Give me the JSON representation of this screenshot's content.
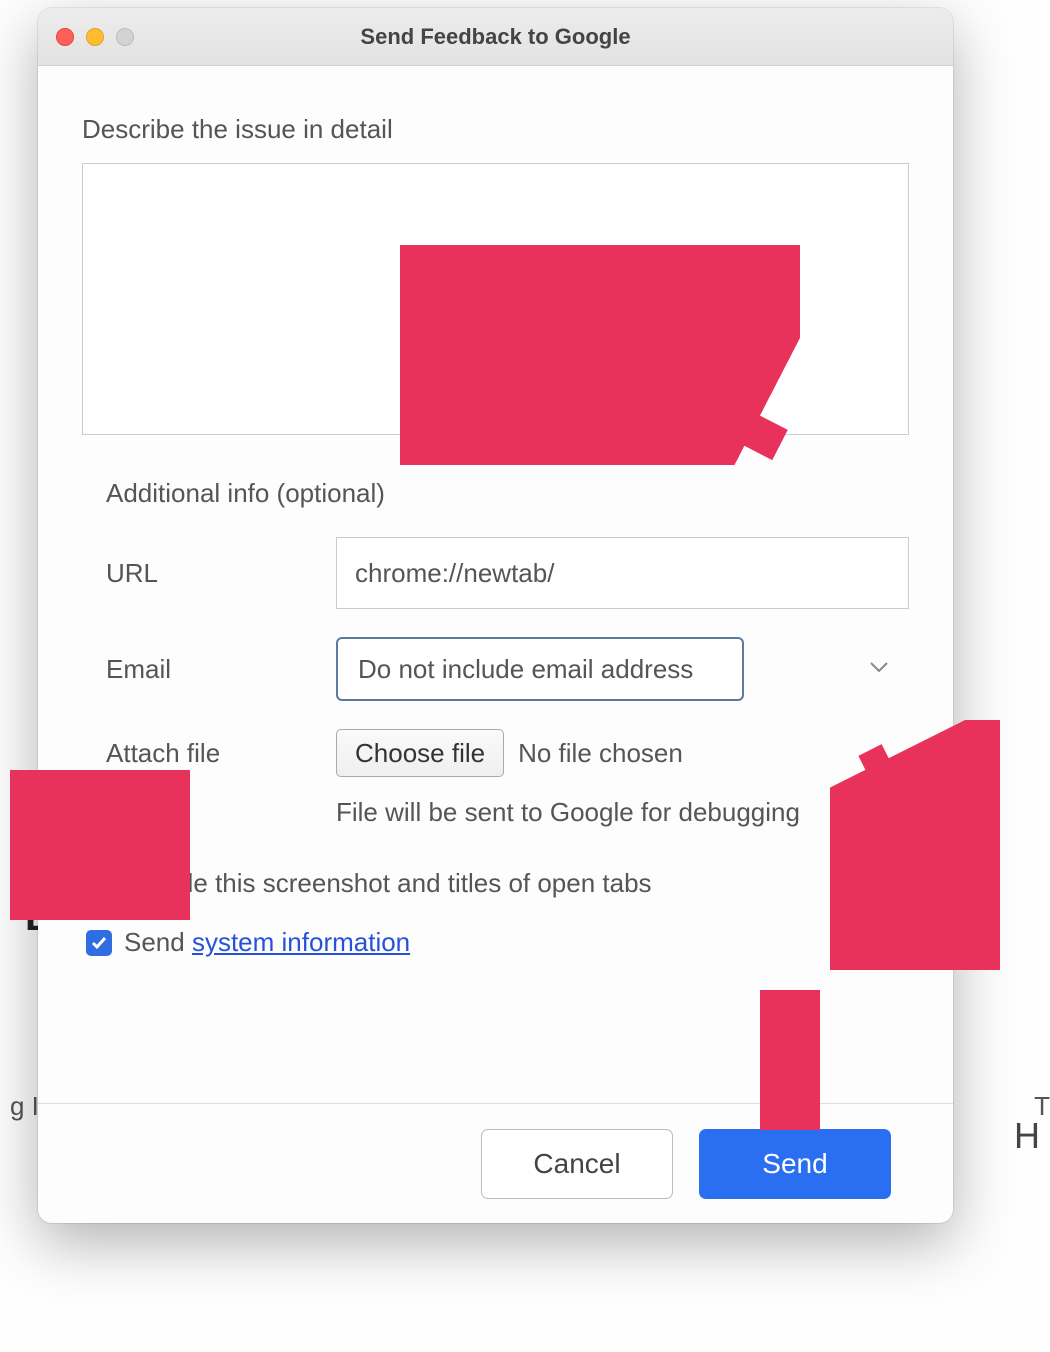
{
  "window": {
    "title": "Send Feedback to Google"
  },
  "main": {
    "describe_label": "Describe the issue in detail",
    "description_value": "",
    "additional_heading": "Additional info (optional)",
    "url_label": "URL",
    "url_value": "chrome://newtab/",
    "email_label": "Email",
    "email_selected": "Do not include email address",
    "attach_label": "Attach file",
    "choose_file_label": "Choose file",
    "file_status": "No file chosen",
    "file_hint": "File will be sent to Google for debugging",
    "screenshot_checkbox_label": "Include this screenshot and titles of open tabs",
    "screenshot_checked": false,
    "sysinfo_prefix": "Send ",
    "sysinfo_link": "system information",
    "sysinfo_checked": true
  },
  "footer": {
    "cancel_label": "Cancel",
    "send_label": "Send"
  },
  "backdrop": {
    "left_text": "g In",
    "right_char": "T",
    "letter_b": "B",
    "letter_h": "H"
  },
  "colors": {
    "accent": "#2a6ff2",
    "arrow": "#e8315b"
  }
}
